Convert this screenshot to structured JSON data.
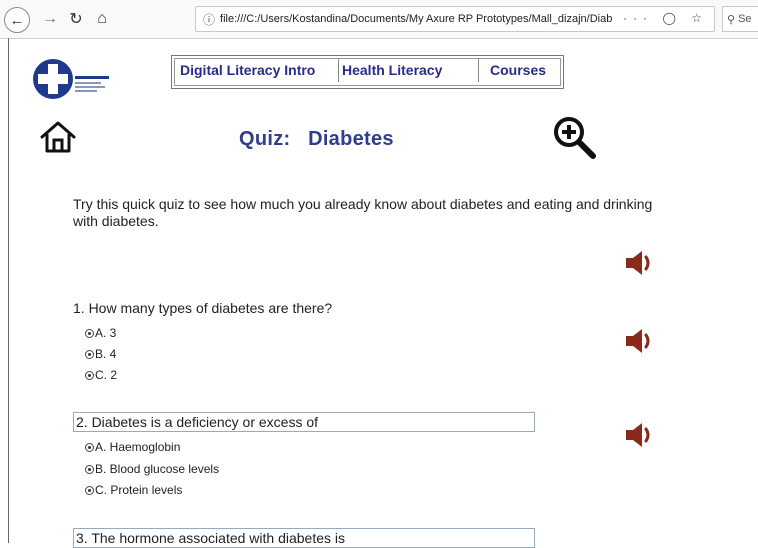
{
  "browser": {
    "url": "file:///C:/Users/Kostandina/Documents/My Axure RP Prototypes/Mall_dizajn/Diab",
    "search_placeholder": "Se"
  },
  "menu": {
    "items": [
      {
        "label": "Digital Literacy Intro"
      },
      {
        "label": "Health Literacy"
      },
      {
        "label": "Courses"
      }
    ]
  },
  "quiz": {
    "title_prefix": "Quiz:",
    "title_topic": "Diabetes",
    "intro": "Try this quick quiz to see how much you already know about diabetes and eating and drinking with diabetes."
  },
  "questions": [
    {
      "text": "1. How many types of diabetes are there?",
      "options": [
        "A. 3",
        "B. 4",
        "C. 2"
      ]
    },
    {
      "text": "2. Diabetes is a deficiency or excess of",
      "options": [
        "A. Haemoglobin",
        "B. Blood glucose levels",
        "C. Protein levels"
      ]
    },
    {
      "text": "3. The hormone associated with diabetes is"
    }
  ],
  "colors": {
    "title": "#2e3d8c",
    "menu_text": "#2a2a8c",
    "speaker": "#8b2a1a",
    "logo_blue": "#1f3a8a"
  },
  "icons": {
    "home": "home-icon",
    "zoom": "zoom-in-icon",
    "speaker": "speaker-icon"
  }
}
